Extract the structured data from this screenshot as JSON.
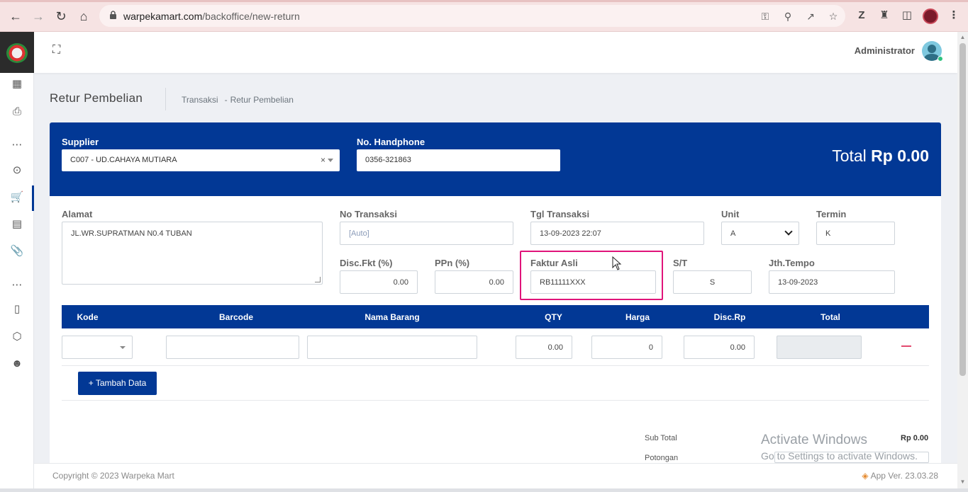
{
  "browser": {
    "url_domain": "warpekamart.com",
    "url_path": "/backoffice/new-return"
  },
  "header": {
    "user_name": "Administrator"
  },
  "page": {
    "title": "Retur Pembelian",
    "breadcrumb": [
      "Transaksi",
      "-",
      "Retur Pembelian"
    ]
  },
  "form_header": {
    "supplier_label": "Supplier",
    "supplier_value": "C007 - UD.CAHAYA MUTIARA",
    "supplier_clear": "×",
    "phone_label": "No. Handphone",
    "phone_value": "0356-321863",
    "total_prefix": "Total",
    "total_value": "Rp 0.00"
  },
  "form": {
    "alamat_label": "Alamat",
    "alamat_value": "JL.WR.SUPRATMAN N0.4 TUBAN",
    "no_transaksi_label": "No Transaksi",
    "no_transaksi_placeholder": "[Auto]",
    "tgl_transaksi_label": "Tgl Transaksi",
    "tgl_transaksi_value": "13-09-2023 22:07",
    "unit_label": "Unit",
    "unit_value": "A",
    "termin_label": "Termin",
    "termin_value": "K",
    "disc_fkt_label": "Disc.Fkt (%)",
    "disc_fkt_value": "0.00",
    "ppn_label": "PPn (%)",
    "ppn_value": "0.00",
    "faktur_asli_label": "Faktur Asli",
    "faktur_asli_value": "RB11111XXX",
    "st_label": "S/T",
    "st_value": "S",
    "jth_tempo_label": "Jth.Tempo",
    "jth_tempo_value": "13-09-2023"
  },
  "table": {
    "columns": [
      "Kode",
      "Barcode",
      "Nama Barang",
      "QTY",
      "Harga",
      "Disc.Rp",
      "Total"
    ],
    "row": {
      "qty": "0.00",
      "harga": "0",
      "disc_rp": "0.00"
    },
    "add_button_label": "Tambah Data",
    "add_button_icon": "+"
  },
  "summary": {
    "sub_total_label": "Sub Total",
    "sub_total_value": "Rp 0.00",
    "potongan_label": "Potongan"
  },
  "watermark": {
    "title": "Activate Windows",
    "subtitle": "Go to Settings to activate Windows."
  },
  "footer": {
    "copyright": "Copyright © 2023 Warpeka Mart",
    "app_version": "App Ver. 23.03.28"
  },
  "colors": {
    "primary": "#023895",
    "highlight": "#e0147a",
    "danger": "#e34a6f"
  },
  "icons": {
    "sidebar": [
      "dashboard-icon",
      "clipboard-icon",
      "more-icon",
      "broadcast-icon",
      "cart-icon",
      "receipt-icon",
      "paperclip-icon",
      "more-icon",
      "book-icon",
      "box-icon",
      "users-icon"
    ]
  }
}
